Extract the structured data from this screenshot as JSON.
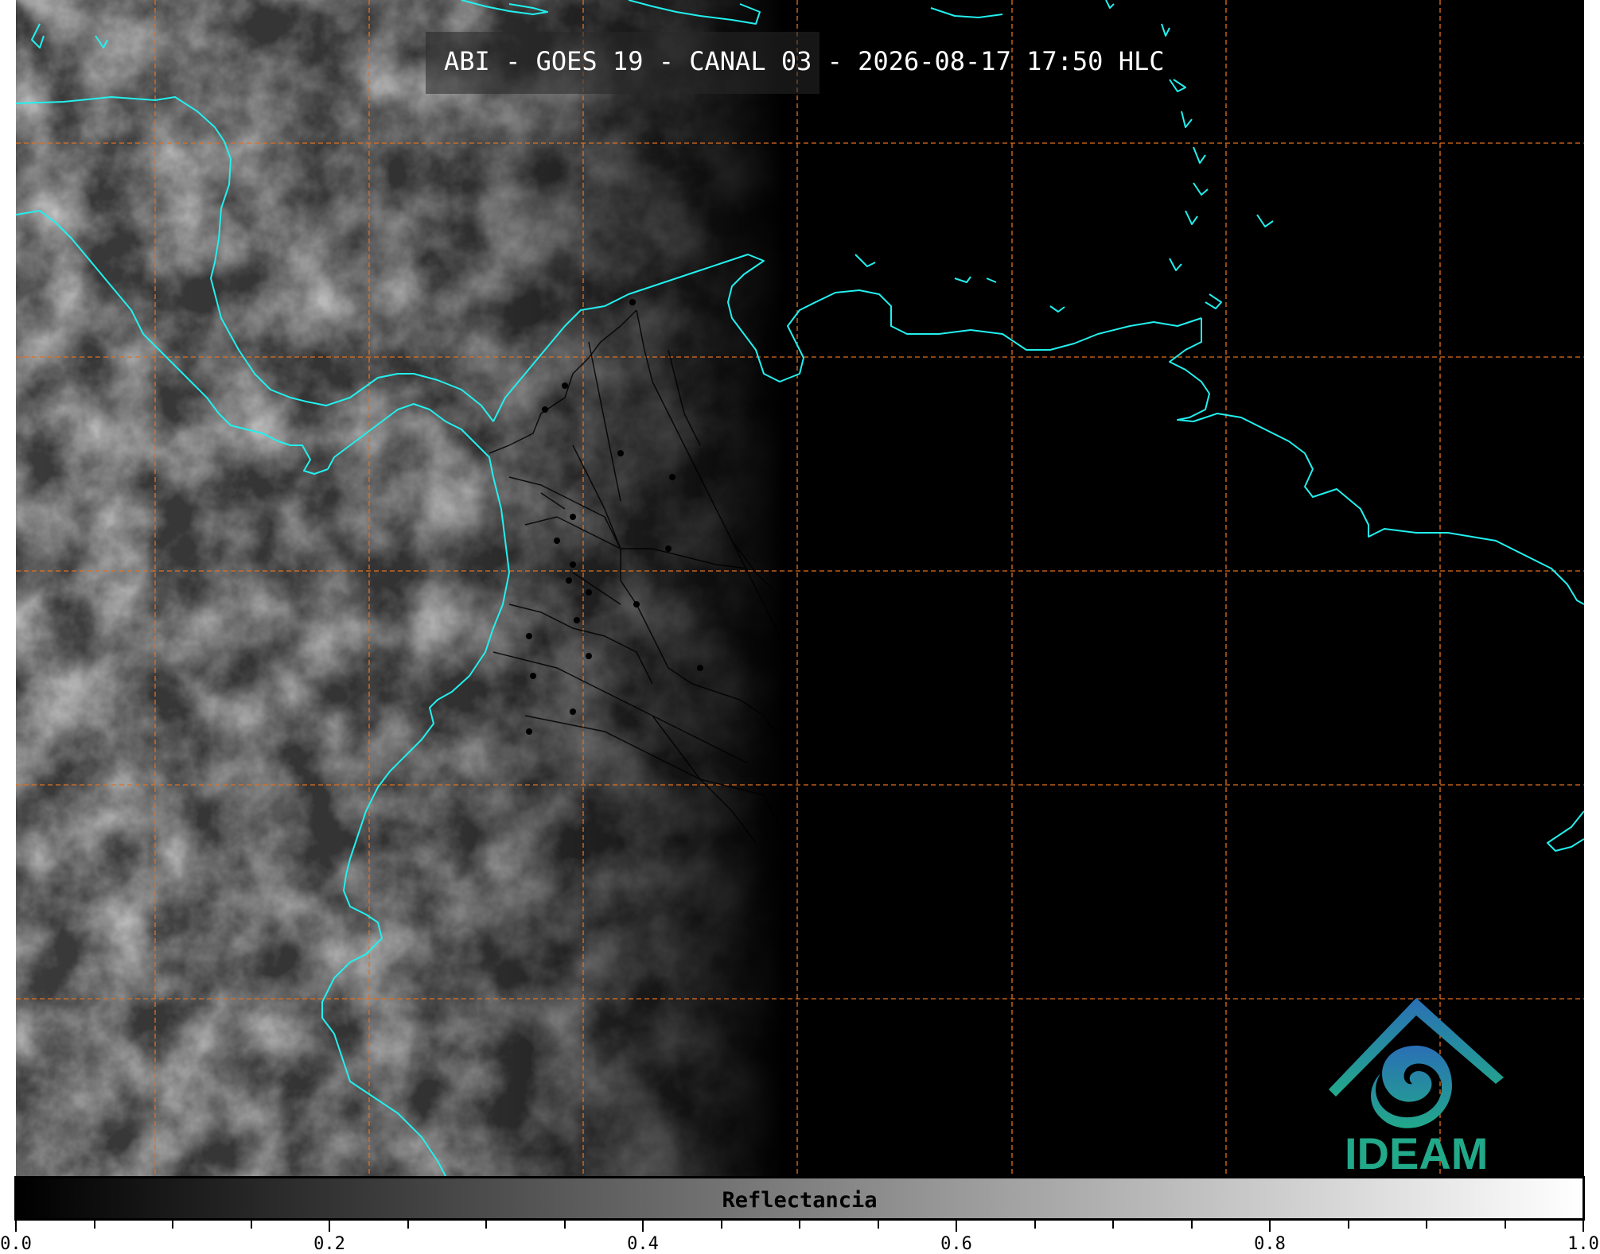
{
  "map": {
    "title": "ABI - GOES 19 - CANAL 03 - 2026-08-17 17:50 HLC",
    "colors": {
      "coastline": "#22f0ee",
      "graticule": "#e0701f",
      "borders": "#000000",
      "clouds": "#9a9a9a"
    },
    "layers": [
      "coastline",
      "graticule",
      "borders",
      "cities"
    ]
  },
  "colorbar": {
    "label": "Reflectancia",
    "range": [
      0.0,
      1.0
    ],
    "colormap": [
      "#000000",
      "#ffffff"
    ],
    "major_ticks": [
      "0.0",
      "0.2",
      "0.4",
      "0.6",
      "0.8",
      "1.0"
    ]
  },
  "logo": {
    "text": "IDEAM",
    "icon": "ideam-logo-icon",
    "color_top": "#2a6fb5",
    "color_bottom": "#22a98a"
  }
}
